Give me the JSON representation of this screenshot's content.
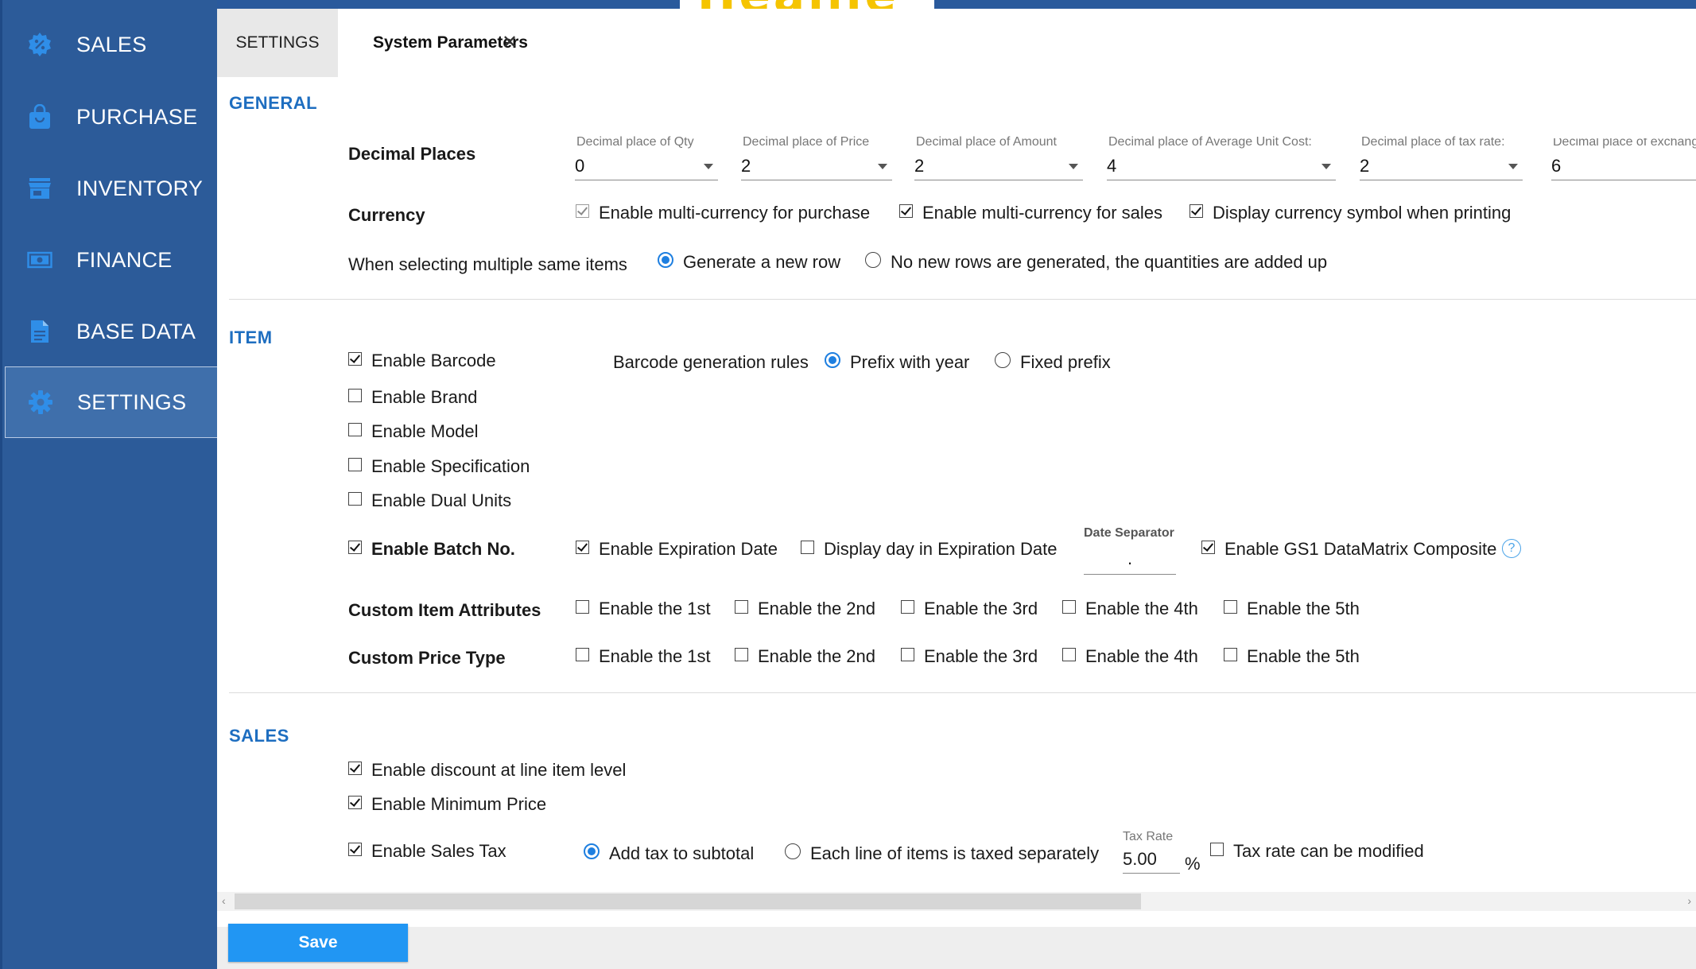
{
  "brand": {
    "logo_text": "Heaille"
  },
  "sidebar": {
    "items": [
      {
        "label": "SALES",
        "icon": "sales-badge-icon"
      },
      {
        "label": "PURCHASE",
        "icon": "shopping-bag-icon"
      },
      {
        "label": "INVENTORY",
        "icon": "store-icon"
      },
      {
        "label": "FINANCE",
        "icon": "money-icon"
      },
      {
        "label": "BASE DATA",
        "icon": "document-icon"
      },
      {
        "label": "SETTINGS",
        "icon": "gear-icon",
        "active": true
      }
    ]
  },
  "tabs": {
    "settings": "SETTINGS",
    "system_parameters": "System Parameters",
    "close": "✕"
  },
  "general": {
    "title": "GENERAL",
    "decimal_places_label": "Decimal Places",
    "decimal_fields": [
      {
        "caption": "Decimal place of Qty",
        "value": "0"
      },
      {
        "caption": "Decimal place of Price",
        "value": "2"
      },
      {
        "caption": "Decimal place of Amount",
        "value": "2"
      },
      {
        "caption": "Decimal place of Average Unit Cost:",
        "value": "4"
      },
      {
        "caption": "Decimal place of tax rate:",
        "value": "2"
      },
      {
        "caption": "Decimal place of exchange",
        "value": "6"
      }
    ],
    "currency_label": "Currency",
    "currency_options": [
      {
        "label": "Enable multi-currency for purchase",
        "checked": true,
        "disabled": true
      },
      {
        "label": "Enable multi-currency for sales",
        "checked": true
      },
      {
        "label": "Display currency symbol when printing",
        "checked": true
      }
    ],
    "same_items_label": "When selecting multiple same items",
    "same_items_options": [
      {
        "label": "Generate a new row",
        "selected": true
      },
      {
        "label": "No new rows are generated, the quantities are added up",
        "selected": false
      }
    ]
  },
  "item": {
    "title": "ITEM",
    "enable_barcode": "Enable Barcode",
    "barcode_rules_label": "Barcode generation rules",
    "barcode_rules": [
      {
        "label": "Prefix with year",
        "selected": true
      },
      {
        "label": "Fixed prefix",
        "selected": false
      }
    ],
    "enable_brand": "Enable Brand",
    "enable_model": "Enable Model",
    "enable_specification": "Enable Specification",
    "enable_dual_units": "Enable Dual Units",
    "enable_batch_no": "Enable Batch No.",
    "enable_expiration_date": "Enable Expiration Date",
    "display_day_expiration": "Display day in Expiration Date",
    "date_separator_caption": "Date Separator",
    "date_separator_value": ".",
    "enable_gs1": "Enable GS1 DataMatrix Composite",
    "help": "?",
    "custom_item_attributes_label": "Custom Item Attributes",
    "custom_price_type_label": "Custom Price Type",
    "enable_ordinals": [
      "Enable the 1st",
      "Enable the 2nd",
      "Enable the 3rd",
      "Enable the 4th",
      "Enable the 5th"
    ]
  },
  "sales": {
    "title": "SALES",
    "enable_line_discount": "Enable discount at line item level",
    "enable_minimum_price": "Enable Minimum Price",
    "enable_sales_tax": "Enable Sales Tax",
    "tax_modes": [
      {
        "label": "Add tax to subtotal",
        "selected": true
      },
      {
        "label": "Each line of items is taxed separately",
        "selected": false
      }
    ],
    "tax_rate_caption": "Tax Rate",
    "tax_rate_value": "5.00",
    "tax_rate_unit": "%",
    "tax_rate_modifiable": "Tax rate can be modified"
  },
  "scrollbar": {
    "left": "‹",
    "right": "›"
  },
  "footer": {
    "save_label": "Save"
  },
  "colors": {
    "sidebar": "#2c5b99",
    "accent": "#1e6ec0",
    "save": "#2196f3"
  }
}
